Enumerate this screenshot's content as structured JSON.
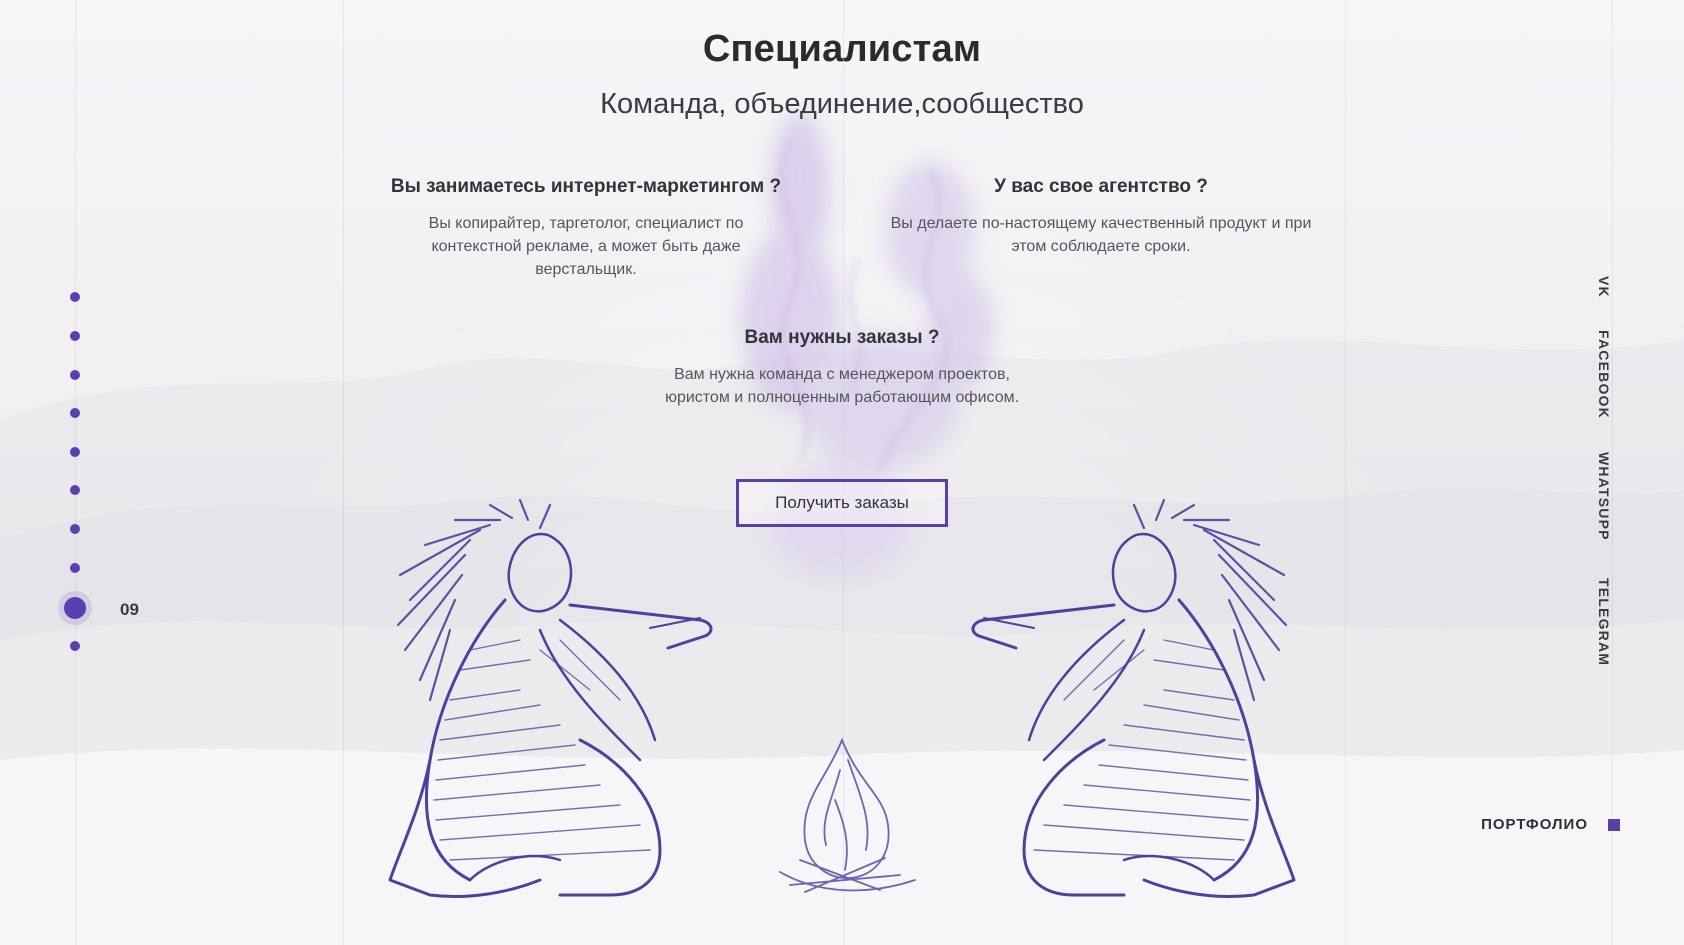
{
  "main": {
    "title": "Специалистам",
    "subtitle": "Команда, объединение,сообщество",
    "blocks": [
      {
        "heading": "Вы занимаетесь интернет-маркетингом ?",
        "text": "Вы копирайтер, таргетолог, специалист по контекстной рекламе, а может быть даже верстальщик."
      },
      {
        "heading": "У вас свое агентство ?",
        "text": "Вы делаете по-настоящему качественный продукт и при этом соблюдаете сроки."
      },
      {
        "heading": "Вам нужны заказы ?",
        "text": "Вам нужна команда с менеджером проектов, юристом и полноценным работающим офисом."
      }
    ],
    "cta_label": "Получить заказы"
  },
  "nav": {
    "current_number": "09",
    "total_dots": 10,
    "active_index": 8
  },
  "social": {
    "links": [
      "VK",
      "FACEBOOK",
      "WHATSUPP",
      "TELEGRAM"
    ]
  },
  "portfolio": {
    "label": "ПОРТФОЛИО"
  },
  "colors": {
    "accent": "#5a3fa8",
    "text_dark": "#2b2b2f",
    "text_muted": "#55555b"
  },
  "icons": {
    "left_figure": "sketch-figure-pipe-left",
    "right_figure": "sketch-figure-pipe-right",
    "campfire": "campfire-sketch-icon",
    "smoke": "smoke-icon"
  }
}
